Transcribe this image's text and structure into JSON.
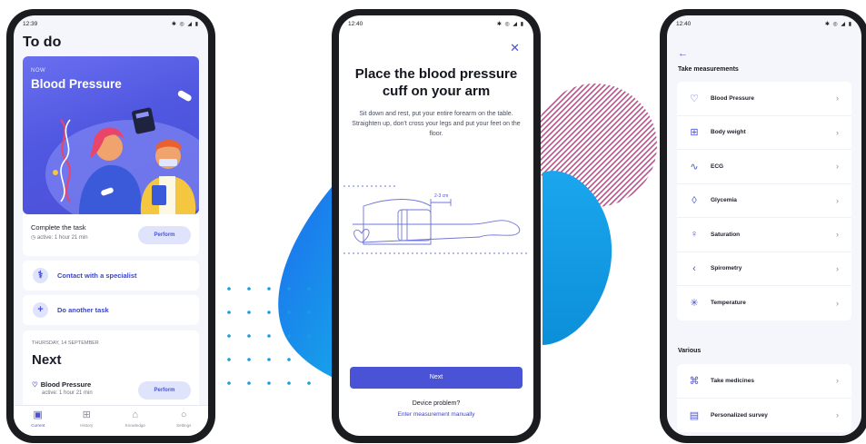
{
  "phone1": {
    "status_time": "12:39",
    "status_icons": "✱ ◎ ◢ ▮",
    "title": "To do",
    "hero": {
      "eyebrow": "NOW",
      "title": "Blood Pressure"
    },
    "task": {
      "label": "Complete the task",
      "time": "active: 1 hour 21 min",
      "button": "Perform"
    },
    "actions": [
      {
        "label": "Contact with a specialist",
        "icon": "stethoscope-icon"
      },
      {
        "label": "Do another task",
        "icon": "plus-icon"
      }
    ],
    "next": {
      "date": "THURSDAY, 14 SEPTEMBER",
      "heading": "Next",
      "item_title": "Blood Pressure",
      "item_time": "active: 1 hour 21 min",
      "button": "Perform"
    },
    "tabs": [
      {
        "label": "Current",
        "icon": "current-icon",
        "glyph": "▣"
      },
      {
        "label": "History",
        "icon": "history-icon",
        "glyph": "⊞"
      },
      {
        "label": "Knowledge",
        "icon": "knowledge-icon",
        "glyph": "⌂"
      },
      {
        "label": "Settings",
        "icon": "settings-icon",
        "glyph": "○"
      }
    ]
  },
  "phone2": {
    "status_time": "12:40",
    "status_icons": "✱ ◎ ◢ ▮",
    "close": "✕",
    "title": "Place the blood pressure cuff on your arm",
    "description": "Sit down and rest, put your entire forearm on the table. Straighten up, don't cross your legs and put your feet on the floor.",
    "measure_label": "2-3 cm",
    "next_button": "Next",
    "problem_text": "Device problem?",
    "manual_link": "Enter measurement manually"
  },
  "phone3": {
    "status_time": "12:40",
    "status_icons": "✱ ◎ ◢ ▮",
    "back": "←",
    "section1": "Take measurements",
    "measurements": [
      {
        "label": "Blood Pressure",
        "icon": "heart-icon",
        "glyph": "♡"
      },
      {
        "label": "Body weight",
        "icon": "scale-icon",
        "glyph": "⊞"
      },
      {
        "label": "ECG",
        "icon": "ecg-icon",
        "glyph": "∿"
      },
      {
        "label": "Glycemia",
        "icon": "drop-icon",
        "glyph": "◊"
      },
      {
        "label": "Saturation",
        "icon": "saturation-icon",
        "glyph": "♀"
      },
      {
        "label": "Spirometry",
        "icon": "lungs-icon",
        "glyph": "‹"
      },
      {
        "label": "Temperature",
        "icon": "temperature-icon",
        "glyph": "✳"
      }
    ],
    "section2": "Various",
    "various": [
      {
        "label": "Take medicines",
        "icon": "pill-icon",
        "glyph": "⌘"
      },
      {
        "label": "Personalized survey",
        "icon": "survey-icon",
        "glyph": "▤"
      }
    ],
    "chevron": "›"
  },
  "colors": {
    "accent": "#4a53d6",
    "accent_light": "#dfe3fb",
    "blob_top": "#1d6ff0",
    "blob_bottom": "#13b8e8",
    "stripes": "#b4307a"
  }
}
